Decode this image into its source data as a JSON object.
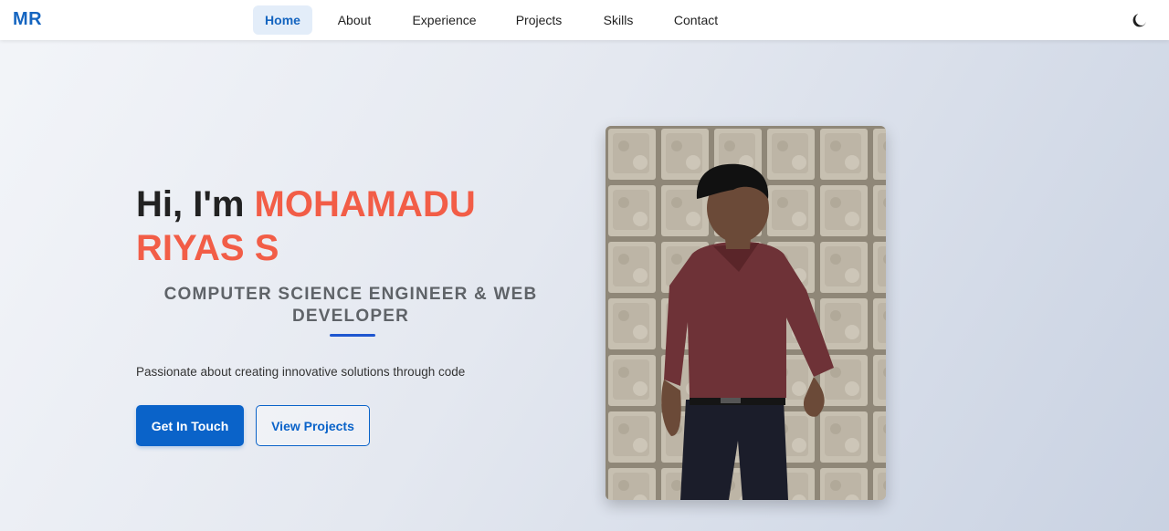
{
  "nav": {
    "logo": "MR",
    "links": [
      "Home",
      "About",
      "Experience",
      "Projects",
      "Skills",
      "Contact"
    ],
    "active": "Home",
    "theme_icon": "moon-icon"
  },
  "hero": {
    "greeting": "Hi, I'm ",
    "name": "MOHAMADU RIYAS S",
    "subtitle": "COMPUTER SCIENCE ENGINEER & WEB DEVELOPER",
    "tagline": "Passionate about creating innovative solutions through code",
    "primary_button": "Get In Touch",
    "secondary_button": "View Projects"
  },
  "colors": {
    "brand_blue": "#0a63c9",
    "name_accent": "#f25d47",
    "divider": "#1e56d0"
  }
}
